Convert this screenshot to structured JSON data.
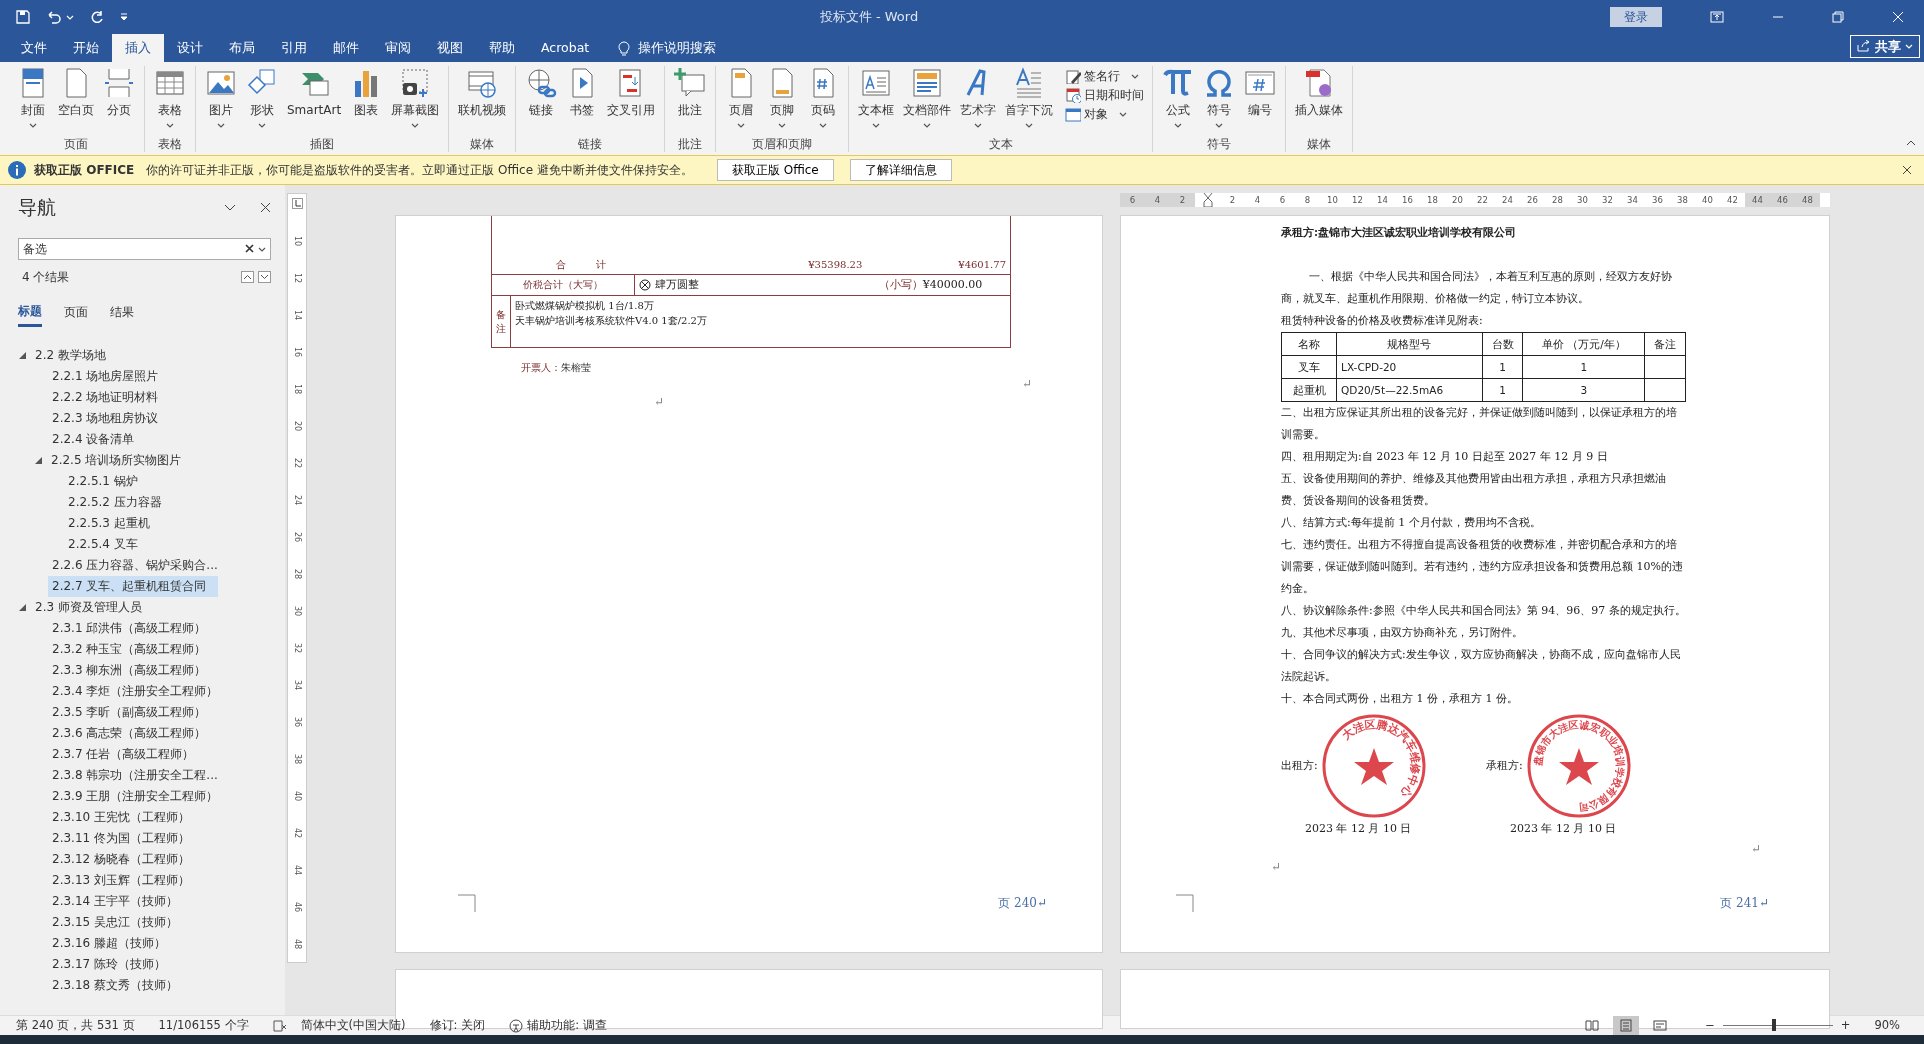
{
  "window": {
    "title": "投标文件 - Word",
    "signin": "登录",
    "share": "共享"
  },
  "menu_tabs": [
    {
      "label": "文件",
      "selected": false
    },
    {
      "label": "开始",
      "selected": false
    },
    {
      "label": "插入",
      "selected": true
    },
    {
      "label": "设计",
      "selected": false
    },
    {
      "label": "布局",
      "selected": false
    },
    {
      "label": "引用",
      "selected": false
    },
    {
      "label": "邮件",
      "selected": false
    },
    {
      "label": "审阅",
      "selected": false
    },
    {
      "label": "视图",
      "selected": false
    },
    {
      "label": "帮助",
      "selected": false
    },
    {
      "label": "Acrobat",
      "selected": false
    }
  ],
  "tell_me": "操作说明搜索",
  "ribbon_groups": [
    {
      "label": "页面",
      "buttons": [
        {
          "label": "封面",
          "kind": "cover",
          "dropdown": true
        },
        {
          "label": "空白页",
          "kind": "blank",
          "dropdown": false
        },
        {
          "label": "分页",
          "kind": "pagebreak",
          "dropdown": false
        }
      ]
    },
    {
      "label": "表格",
      "buttons": [
        {
          "label": "表格",
          "kind": "table",
          "dropdown": true
        }
      ]
    },
    {
      "label": "插图",
      "buttons": [
        {
          "label": "图片",
          "kind": "picture",
          "dropdown": true
        },
        {
          "label": "形状",
          "kind": "shapes",
          "dropdown": true
        },
        {
          "label": "SmartArt",
          "kind": "smartart",
          "dropdown": false
        },
        {
          "label": "图表",
          "kind": "chart",
          "dropdown": false
        },
        {
          "label": "屏幕截图",
          "kind": "screenshot",
          "dropdown": true
        }
      ]
    },
    {
      "label": "媒体",
      "buttons": [
        {
          "label": "联机视频",
          "kind": "video",
          "dropdown": false
        }
      ]
    },
    {
      "label": "链接",
      "buttons": [
        {
          "label": "链接",
          "kind": "link",
          "dropdown": false
        },
        {
          "label": "书签",
          "kind": "bookmark",
          "dropdown": false
        },
        {
          "label": "交叉引用",
          "kind": "crossref",
          "dropdown": false
        }
      ]
    },
    {
      "label": "批注",
      "buttons": [
        {
          "label": "批注",
          "kind": "comment",
          "dropdown": false
        }
      ]
    },
    {
      "label": "页眉和页脚",
      "buttons": [
        {
          "label": "页眉",
          "kind": "header",
          "dropdown": true
        },
        {
          "label": "页脚",
          "kind": "footer",
          "dropdown": true
        },
        {
          "label": "页码",
          "kind": "pagenum",
          "dropdown": true
        }
      ]
    },
    {
      "label": "文本",
      "buttons": [
        {
          "label": "文本框",
          "kind": "textbox",
          "dropdown": true
        },
        {
          "label": "文档部件",
          "kind": "quickparts",
          "dropdown": true
        },
        {
          "label": "艺术字",
          "kind": "wordart",
          "dropdown": true
        },
        {
          "label": "首字下沉",
          "kind": "dropcap",
          "dropdown": true
        },
        {
          "label": "签名行",
          "kind": "signature",
          "dropdown": true
        },
        {
          "label": "日期和时间",
          "kind": "datetime",
          "dropdown": false
        },
        {
          "label": "对象",
          "kind": "object",
          "dropdown": true
        }
      ]
    },
    {
      "label": "符号",
      "buttons": [
        {
          "label": "公式",
          "kind": "equation",
          "dropdown": true
        },
        {
          "label": "符号",
          "kind": "symbol",
          "dropdown": true
        },
        {
          "label": "编号",
          "kind": "number",
          "dropdown": false
        }
      ]
    },
    {
      "label": "媒体",
      "buttons": [
        {
          "label": "插入媒体",
          "kind": "media",
          "dropdown": false
        }
      ]
    }
  ],
  "info_bar": {
    "title": "获取正版 OFFICE",
    "message": "你的许可证并非正版，你可能是盗版软件的受害者。立即通过正版 Office 避免中断并使文件保持安全。",
    "buttons": [
      "获取正版 Office",
      "了解详细信息"
    ]
  },
  "navigation": {
    "title": "导航",
    "search": "备选",
    "results": "4 个结果",
    "tabs": [
      {
        "label": "标题",
        "selected": true
      },
      {
        "label": "页面",
        "selected": false
      },
      {
        "label": "结果",
        "selected": false
      }
    ],
    "tree": [
      {
        "label": "2.2 教学场地",
        "expanded": true,
        "selected": false,
        "children": [
          {
            "label": "2.2.1 场地房屋照片",
            "selected": false
          },
          {
            "label": "2.2.2 场地证明材料",
            "selected": false
          },
          {
            "label": "2.2.3 场地租房协议",
            "selected": false
          },
          {
            "label": "2.2.4 设备清单",
            "selected": false
          },
          {
            "label": "2.2.5 培训场所实物图片",
            "expanded": true,
            "selected": false,
            "children": [
              {
                "label": "2.2.5.1 锅炉",
                "selected": false
              },
              {
                "label": "2.2.5.2 压力容器",
                "selected": false
              },
              {
                "label": "2.2.5.3 起重机",
                "selected": false
              },
              {
                "label": "2.2.5.4 叉车",
                "selected": false
              }
            ]
          },
          {
            "label": "2.2.6 压力容器、锅炉采购合...",
            "selected": false
          },
          {
            "label": "2.2.7 叉车、起重机租赁合同",
            "selected": true
          }
        ]
      },
      {
        "label": "2.3 师资及管理人员",
        "expanded": true,
        "selected": false,
        "children": [
          {
            "label": "2.3.1 邱洪伟（高级工程师）",
            "selected": false
          },
          {
            "label": "2.3.2 种玉宝（高级工程师）",
            "selected": false
          },
          {
            "label": "2.3.3 柳东洲（高级工程师）",
            "selected": false
          },
          {
            "label": "2.3.4 李炬（注册安全工程师）",
            "selected": false
          },
          {
            "label": "2.3.5 李昕（副高级工程师）",
            "selected": false
          },
          {
            "label": "2.3.6 高志荣（高级工程师）",
            "selected": false
          },
          {
            "label": "2.3.7 任岩（高级工程师）",
            "selected": false
          },
          {
            "label": "2.3.8 韩宗功（注册安全工程...",
            "selected": false
          },
          {
            "label": "2.3.9 王朋（注册安全工程师）",
            "selected": false
          },
          {
            "label": "2.3.10 王宪忱（工程师）",
            "selected": false
          },
          {
            "label": "2.3.11 佟为国（工程师）",
            "selected": false
          },
          {
            "label": "2.3.12 杨晓春（工程师）",
            "selected": false
          },
          {
            "label": "2.3.13 刘玉辉（工程师）",
            "selected": false
          },
          {
            "label": "2.3.14 王宇平（技师）",
            "selected": false
          },
          {
            "label": "2.3.15 吴忠江（技师）",
            "selected": false
          },
          {
            "label": "2.3.16 滕超（技师）",
            "selected": false
          },
          {
            "label": "2.3.17 陈玲（技师）",
            "selected": false
          },
          {
            "label": "2.3.18 蔡文秀（技师）",
            "selected": false
          }
        ]
      }
    ]
  },
  "rulers": {
    "horizontal": [
      "6",
      "4",
      "2",
      "2",
      "4",
      "6",
      "8",
      "10",
      "12",
      "14",
      "16",
      "18",
      "20",
      "22",
      "24",
      "26",
      "28",
      "30",
      "32",
      "34",
      "36",
      "38",
      "40",
      "42",
      "44",
      "46",
      "48"
    ],
    "vertical": [
      "10",
      "12",
      "14",
      "16",
      "18",
      "20",
      "22",
      "24",
      "26",
      "28",
      "30",
      "32",
      "34",
      "36",
      "38",
      "40",
      "42",
      "44",
      "46",
      "48"
    ]
  },
  "left_page": {
    "invoice": {
      "total_label": "合　　　计",
      "total_amount": "¥35398.23",
      "total_tax": "¥4601.77",
      "sum_label": "价税合计（大写）",
      "sum_words": "肆万圆整",
      "sum_small_label": "（小写）",
      "sum_small": "¥40000.00",
      "remarks_label": "备注",
      "remarks": [
        "卧式燃煤锅炉模拟机 1台/1.8万",
        "天丰锅炉培训考核系统软件V4.0 1套/2.2万"
      ],
      "issuer_label": "开票人：",
      "issuer": "朱榕莹"
    },
    "paragraph_marks": [
      "↵",
      "↵"
    ],
    "footer": "页 240↵"
  },
  "right_page": {
    "lessee": "承租方:盘锦市大洼区诚宏职业培训学校有限公司",
    "intro": [
      "一、根据《中华人民共和国合同法》，本着互利互惠的原则，经双方友好协商，就叉车、起重机作用限期、价格做一约定，特订立本协议。",
      "租赁特种设备的价格及收费标准详见附表:"
    ],
    "table": {
      "columns": [
        "名称",
        "规格型号",
        "台数",
        "单价 （万元/年）",
        "备注"
      ],
      "rows": [
        [
          "叉车",
          "LX-CPD-20",
          "1",
          "1",
          ""
        ],
        [
          "起重机",
          "QD20/5t—22.5mA6",
          "1",
          "3",
          ""
        ]
      ]
    },
    "clauses": [
      "二、出租方应保证其所出租的设备完好，并保证做到随叫随到，以保证承租方的培训需要。",
      "四、租用期定为:自 2023 年 12 月 10 日起至 2027 年 12 月 9 日",
      "五、设备使用期间的养护、维修及其他费用皆由出租方承担，承租方只承担燃油费、赁设备期间的设备租赁费。",
      "八、结算方式:每年提前 1 个月付款，费用均不含税。",
      "七、违约责任。出租方不得擅自提高设备租赁的收费标准，并密切配合承和方的培训需要，保证做到随叫随到。若有违约，违约方应承担设备和赁费用总额 10%的违约金。",
      "八、协议解除条件:参照《中华人民共和国合同法》第 94、96、97 条的规定执行。",
      "九、其他术尽事项，由双方协商补充，另订附件。",
      "十、合同争议的解决方式:发生争议，双方应协商解决，协商不成，应向盘锦市人民法院起诉。",
      "十、本合同式两份，出租方 1 份，承租方 1 份。"
    ],
    "signatures": [
      {
        "label": "出租方:",
        "seal_text": "大洼区腾达汽车维修中心",
        "date": "2023 年 12 月 10 日"
      },
      {
        "label": "承租方:",
        "seal_text": "盘锦市大洼区诚宏职业培训学校有限公司",
        "date": "2023 年 12 月 10 日"
      }
    ],
    "paragraph_marks": [
      "↵",
      "↵"
    ],
    "footer": "页 241↵"
  },
  "status_bar": {
    "page": "第 240 页，共 531 页",
    "words": "11/106155 个字",
    "language": "简体中文(中国大陆)",
    "track_changes": "修订: 关闭",
    "accessibility": "辅助功能: 调查",
    "views": [
      {
        "selected": false
      },
      {
        "selected": true
      },
      {
        "selected": false
      }
    ],
    "zoom_out": "−",
    "zoom_in": "+",
    "zoom": {
      "level": 0.46,
      "reading": "90%"
    }
  }
}
